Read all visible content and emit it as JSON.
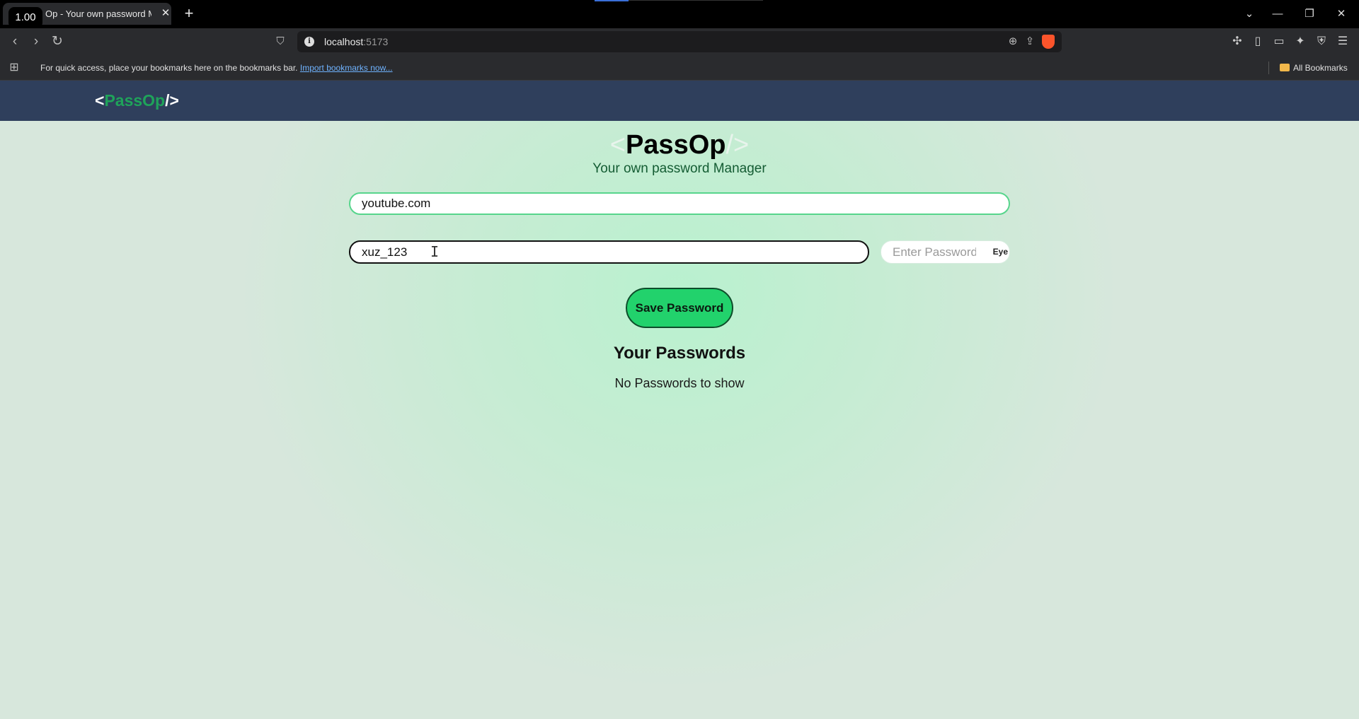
{
  "browser": {
    "zoom_badge": "1.00",
    "tab_title": "Op - Your own password Ma",
    "tab_close": "✕",
    "new_tab": "+",
    "url_host": "localhost",
    "url_port": ":5173",
    "bookmarks_prompt": "For quick access, place your bookmarks here on the bookmarks bar.",
    "import_link": "Import bookmarks now...",
    "all_bookmarks": "All Bookmarks"
  },
  "nav": {
    "logo_open": "<",
    "logo_name": "PassOp",
    "logo_close": "/>"
  },
  "hero": {
    "open": "<",
    "name": "PassOp",
    "close": "/>",
    "subtitle": "Your own password Manager"
  },
  "form": {
    "site_value": "youtube.com",
    "username_value": "xuz_123",
    "password_placeholder": "Enter Password",
    "eye_label": "Eye",
    "save_label": "Save Password"
  },
  "list": {
    "title": "Your Passwords",
    "empty_message": "No Passwords to show"
  },
  "colors": {
    "accent_green": "#22d26c",
    "navbar": "#2f3f5c",
    "logo_green": "#1fa35a"
  }
}
